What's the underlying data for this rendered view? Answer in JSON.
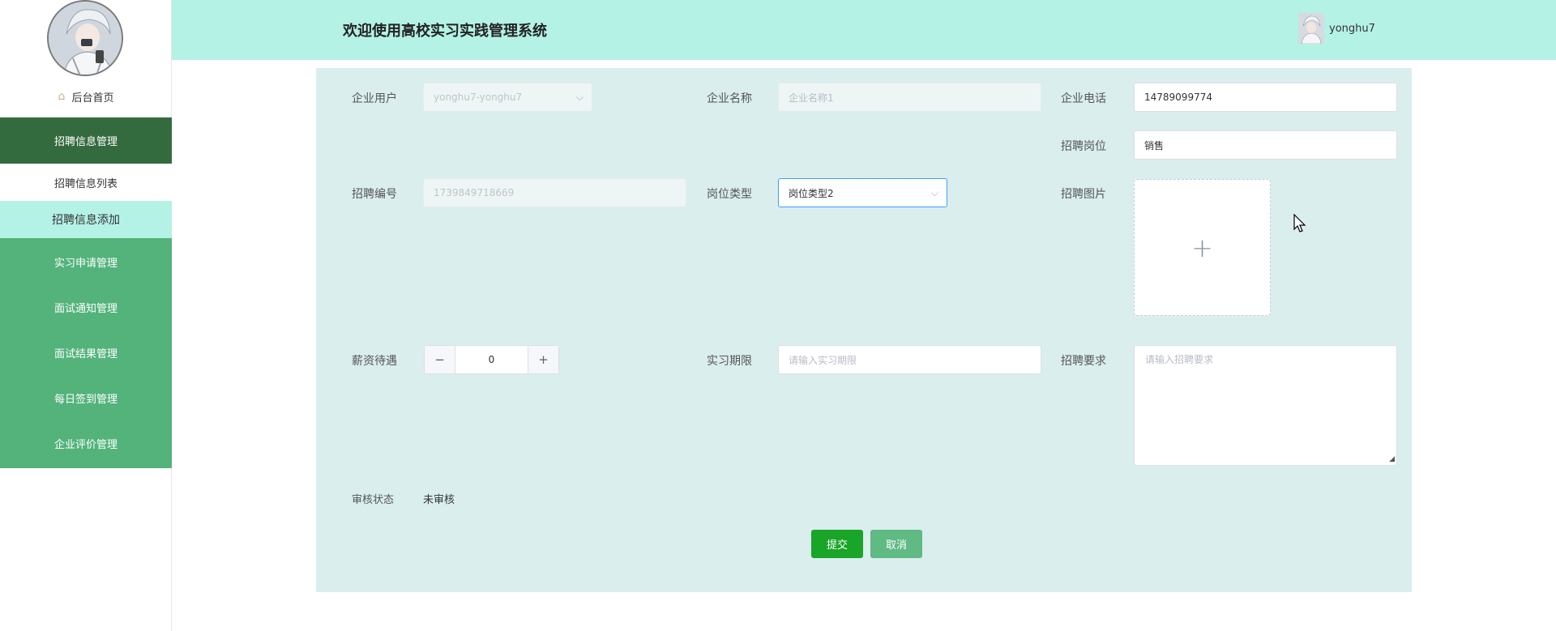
{
  "header": {
    "title": "欢迎使用高校实习实践管理系统",
    "username": "yonghu7"
  },
  "sidebar": {
    "home": "后台首页",
    "menu": [
      {
        "label": "招聘信息管理",
        "active": true
      },
      {
        "label": "招聘信息列表"
      },
      {
        "label": "招聘信息添加",
        "selected": true
      },
      {
        "label": "实习申请管理"
      },
      {
        "label": "面试通知管理"
      },
      {
        "label": "面试结果管理"
      },
      {
        "label": "每日签到管理"
      },
      {
        "label": "企业评价管理"
      }
    ]
  },
  "form": {
    "company_user": {
      "label": "企业用户",
      "value": "yonghu7-yonghu7"
    },
    "company_name": {
      "label": "企业名称",
      "placeholder": "企业名称1"
    },
    "company_phone": {
      "label": "企业电话",
      "value": "14789099774"
    },
    "job_position": {
      "label": "招聘岗位",
      "value": "销售"
    },
    "job_number": {
      "label": "招聘编号",
      "value": "1739849718669"
    },
    "job_type": {
      "label": "岗位类型",
      "value": "岗位类型2"
    },
    "job_image": {
      "label": "招聘图片",
      "icon": "plus-icon"
    },
    "salary": {
      "label": "薪资待遇",
      "value": "0",
      "minus": "−",
      "plus": "+"
    },
    "internship_period": {
      "label": "实习期限",
      "placeholder": "请输入实习期限"
    },
    "requirements": {
      "label": "招聘要求",
      "placeholder": "请输入招聘要求"
    },
    "review_status": {
      "label": "审核状态",
      "value": "未审核"
    }
  },
  "buttons": {
    "submit": "提交",
    "cancel": "取消"
  },
  "colors": {
    "header_bg": "#b4f2e6",
    "menu_bg": "#53b37b",
    "menu_active_bg": "#336b3f",
    "submenu_selected_bg": "#b4f2e6",
    "panel_bg": "#daeeee",
    "submit_bg": "#18a528",
    "cancel_bg": "#5fba83"
  }
}
